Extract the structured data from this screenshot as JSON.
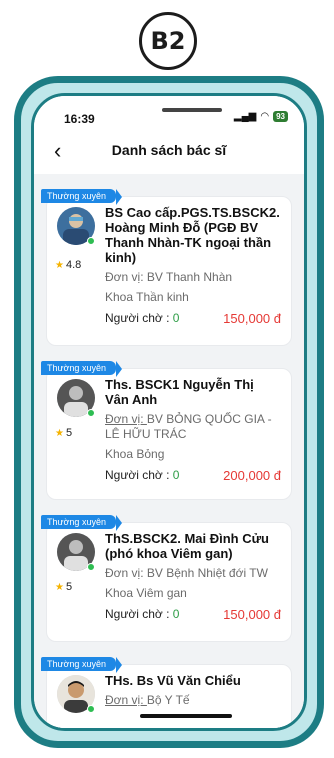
{
  "step_badge": "B2",
  "status": {
    "time": "16:39",
    "battery": "93"
  },
  "nav": {
    "back_icon": "chevron-left",
    "title": "Danh sách bác sĩ"
  },
  "labels": {
    "waiting": "Người chờ : ",
    "unit_prefix": "Đơn vị: "
  },
  "colors": {
    "tag": "#1e88e5",
    "price": "#e53935",
    "waiting_count": "#2e9d47",
    "online": "#2ebd52",
    "frame": "#1d7d84"
  },
  "doctors": [
    {
      "tag": "Thường xuyên",
      "name": "BS Cao cấp.PGS.TS.BSCK2. Hoàng Minh Đỗ (PGĐ BV Thanh Nhàn-TK ngoại thần kinh)",
      "rating": "4.8",
      "unit": "Đơn vị: BV Thanh Nhàn",
      "department": "Khoa Thần kinh",
      "waiting": "0",
      "price": "150,000 đ"
    },
    {
      "tag": "Thường xuyên",
      "name": "Ths. BSCK1 Nguyễn Thị Vân Anh",
      "rating": "5",
      "unit": "BV BỎNG QUỐC GIA - LÊ HỮU TRÁC",
      "department": "Khoa Bỏng",
      "waiting": "0",
      "price": "200,000 đ"
    },
    {
      "tag": "Thường xuyên",
      "name": "ThS.BSCK2. Mai Đình Cửu (phó khoa Viêm gan)",
      "rating": "5",
      "unit": "Đơn vị: BV Bệnh Nhiệt đới TW",
      "department": "Khoa Viêm gan",
      "waiting": "0",
      "price": "150,000 đ"
    },
    {
      "tag": "Thường xuyên",
      "name": "THs. Bs Vũ Văn Chiểu",
      "unit": "Bộ Y Tế"
    }
  ]
}
